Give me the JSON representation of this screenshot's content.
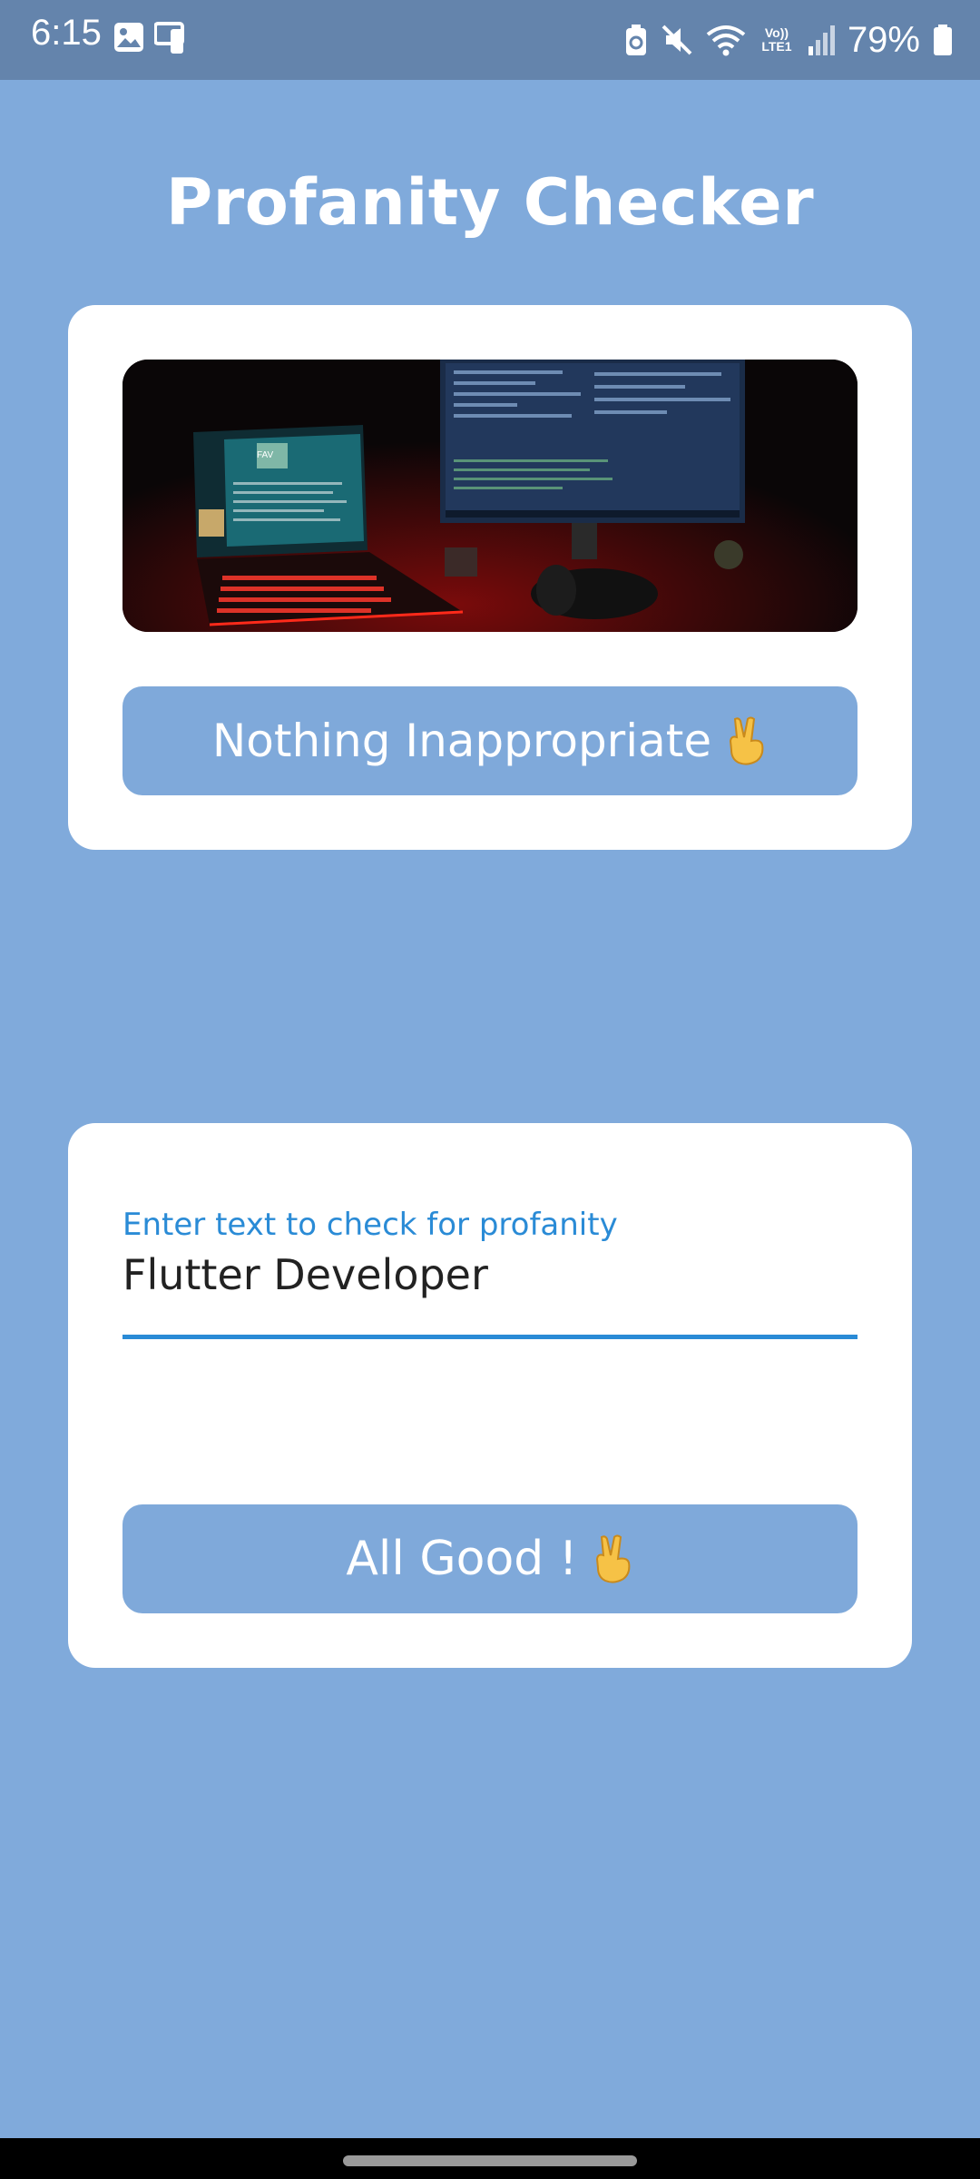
{
  "status_bar": {
    "time": "6:15",
    "battery_percent": "79%",
    "icons": [
      "image-icon",
      "screen-mirror-icon",
      "battery-saver-icon",
      "mute-icon",
      "wifi-icon",
      "volte-icon",
      "signal-icon",
      "battery-icon"
    ],
    "volte_label": "Vo)) LTE1"
  },
  "app": {
    "title": "Profanity Checker"
  },
  "image_card": {
    "photo_caption": "FAV",
    "result_label": "Nothing Inappropriate",
    "result_icon": "victory-hand-icon"
  },
  "text_card": {
    "field_label": "Enter text to check for profanity",
    "field_value": "Flutter Developer",
    "result_label": "All Good !",
    "result_icon": "victory-hand-icon"
  },
  "colors": {
    "background": "#80aadb",
    "status_bar": "#6484ac",
    "button": "#7fa9da",
    "accent": "#2a8bd6"
  }
}
